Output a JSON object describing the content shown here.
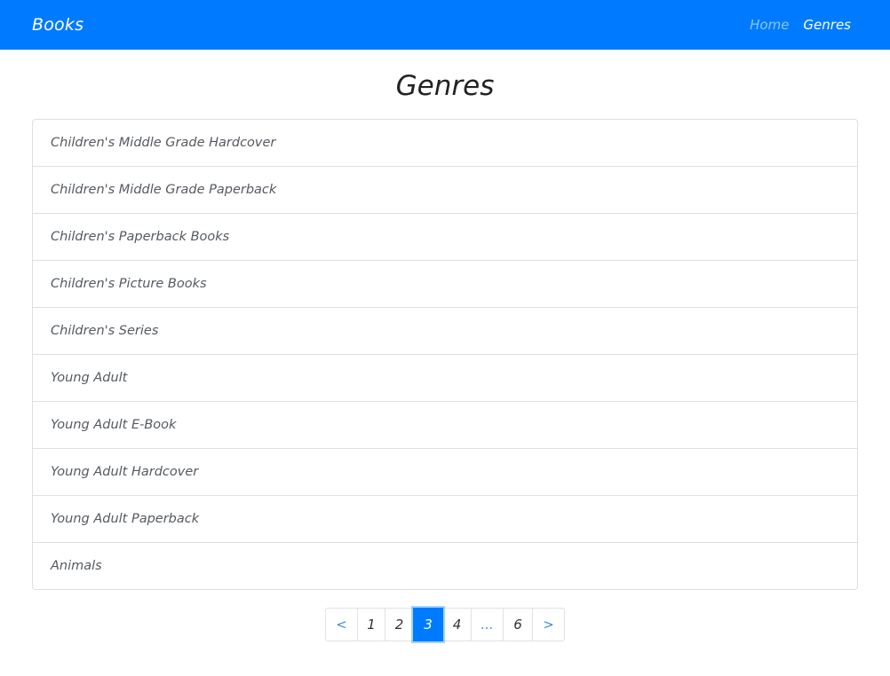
{
  "navbar": {
    "brand": "Books",
    "links": [
      {
        "label": "Home",
        "active": false
      },
      {
        "label": "Genres",
        "active": true
      }
    ]
  },
  "page": {
    "title": "Genres"
  },
  "genres": [
    "Children's Middle Grade Hardcover",
    "Children's Middle Grade Paperback",
    "Children's Paperback Books",
    "Children's Picture Books",
    "Children's Series",
    "Young Adult",
    "Young Adult E-Book",
    "Young Adult Hardcover",
    "Young Adult Paperback",
    "Animals"
  ],
  "pagination": {
    "prev_label": "<",
    "next_label": ">",
    "ellipsis": "...",
    "pages": [
      "1",
      "2",
      "3",
      "4"
    ],
    "last_page": "6",
    "current_page": "3"
  },
  "colors": {
    "primary": "#007bff",
    "text": "#555a60"
  }
}
